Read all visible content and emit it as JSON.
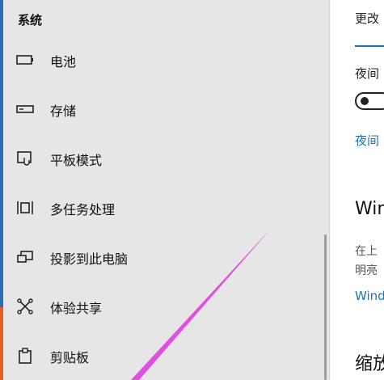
{
  "sidebar": {
    "section_title": "系统",
    "items": [
      {
        "label": "电池",
        "icon": "battery-icon"
      },
      {
        "label": "存储",
        "icon": "storage-icon"
      },
      {
        "label": "平板模式",
        "icon": "tablet-mode-icon"
      },
      {
        "label": "多任务处理",
        "icon": "multitasking-icon"
      },
      {
        "label": "投影到此电脑",
        "icon": "project-to-pc-icon"
      },
      {
        "label": "体验共享",
        "icon": "shared-experiences-icon"
      },
      {
        "label": "剪贴板",
        "icon": "clipboard-icon"
      }
    ]
  },
  "content": {
    "header": "更改",
    "night_light_label": "夜间",
    "night_light_toggle": "off",
    "night_light_link": "夜间",
    "win_heading": "Win",
    "desc_line1": "在上",
    "desc_line2": "明亮",
    "win_link": "Wind",
    "scale_heading": "缩放"
  },
  "colors": {
    "accent": "#1a73b8",
    "annotation": "#e03ee0",
    "sidebar_bg": "#e6e6e6"
  }
}
